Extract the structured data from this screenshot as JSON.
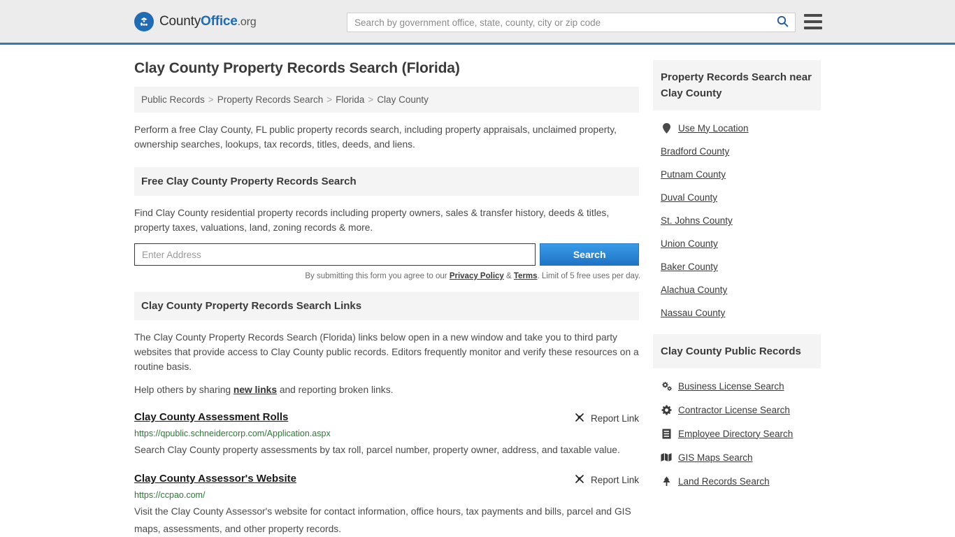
{
  "header": {
    "logo": {
      "part1": "County",
      "part2": "Office",
      "part3": ".org",
      "icon": "eagle-seal-icon"
    },
    "search": {
      "placeholder": "Search by government office, state, county, city or zip code",
      "value": "",
      "icon": "search-icon"
    },
    "menu_icon": "hamburger-menu-icon",
    "accent_color": "#3478b0"
  },
  "page_title": "Clay County Property Records Search (Florida)",
  "breadcrumb": {
    "separator": ">",
    "items": [
      "Public Records",
      "Property Records Search",
      "Florida",
      "Clay County"
    ]
  },
  "intro": "Perform a free Clay County, FL public property records search, including property appraisals, unclaimed property, ownership searches, lookups, tax records, titles, deeds, and liens.",
  "free_search": {
    "heading": "Free Clay County Property Records Search",
    "description": "Find Clay County residential property records including property owners, sales & transfer history, deeds & titles, property taxes, valuations, land, zoning records & more.",
    "address_placeholder": "Enter Address",
    "address_value": "",
    "button_label": "Search",
    "button_color": "#1f73c4",
    "note_prefix": "By submitting this form you agree to our ",
    "note_privacy": "Privacy Policy",
    "note_amp": " & ",
    "note_terms": "Terms",
    "note_suffix": ". Limit of 5 free uses per day."
  },
  "links_section": {
    "heading": "Clay County Property Records Search Links",
    "paragraph": "The Clay County Property Records Search (Florida) links below open in a new window and take you to third party websites that provide access to Clay County public records. Editors frequently monitor and verify these resources on a routine basis.",
    "help_prefix": "Help others by sharing ",
    "help_link": "new links",
    "help_suffix": " and reporting broken links.",
    "report_label": "Report Link",
    "report_icon": "broken-link-icon",
    "results": [
      {
        "title": "Clay County Assessment Rolls",
        "url": "https://qpublic.schneidercorp.com/Application.aspx",
        "description": "Search Clay County property assessments by tax roll, parcel number, property owner, address, and taxable value."
      },
      {
        "title": "Clay County Assessor's Website",
        "url": "https://ccpao.com/",
        "description": "Visit the Clay County Assessor's website for contact information, office hours, tax payments and bills, parcel and GIS maps, assessments, and other property records."
      }
    ]
  },
  "sidebar": {
    "nearby": {
      "heading": "Property Records Search near Clay County",
      "items": [
        {
          "label": "Use My Location",
          "icon": "map-pin-icon"
        },
        {
          "label": "Bradford County",
          "icon": ""
        },
        {
          "label": "Putnam County",
          "icon": ""
        },
        {
          "label": "Duval County",
          "icon": ""
        },
        {
          "label": "St. Johns County",
          "icon": ""
        },
        {
          "label": "Union County",
          "icon": ""
        },
        {
          "label": "Baker County",
          "icon": ""
        },
        {
          "label": "Alachua County",
          "icon": ""
        },
        {
          "label": "Nassau County",
          "icon": ""
        }
      ]
    },
    "public_records": {
      "heading": "Clay County Public Records",
      "items": [
        {
          "label": "Business License Search",
          "icon": "cogs-icon"
        },
        {
          "label": "Contractor License Search",
          "icon": "cog-icon"
        },
        {
          "label": "Employee Directory Search",
          "icon": "book-icon"
        },
        {
          "label": "GIS Maps Search",
          "icon": "map-icon"
        },
        {
          "label": "Land Records Search",
          "icon": "tree-icon"
        }
      ]
    }
  }
}
